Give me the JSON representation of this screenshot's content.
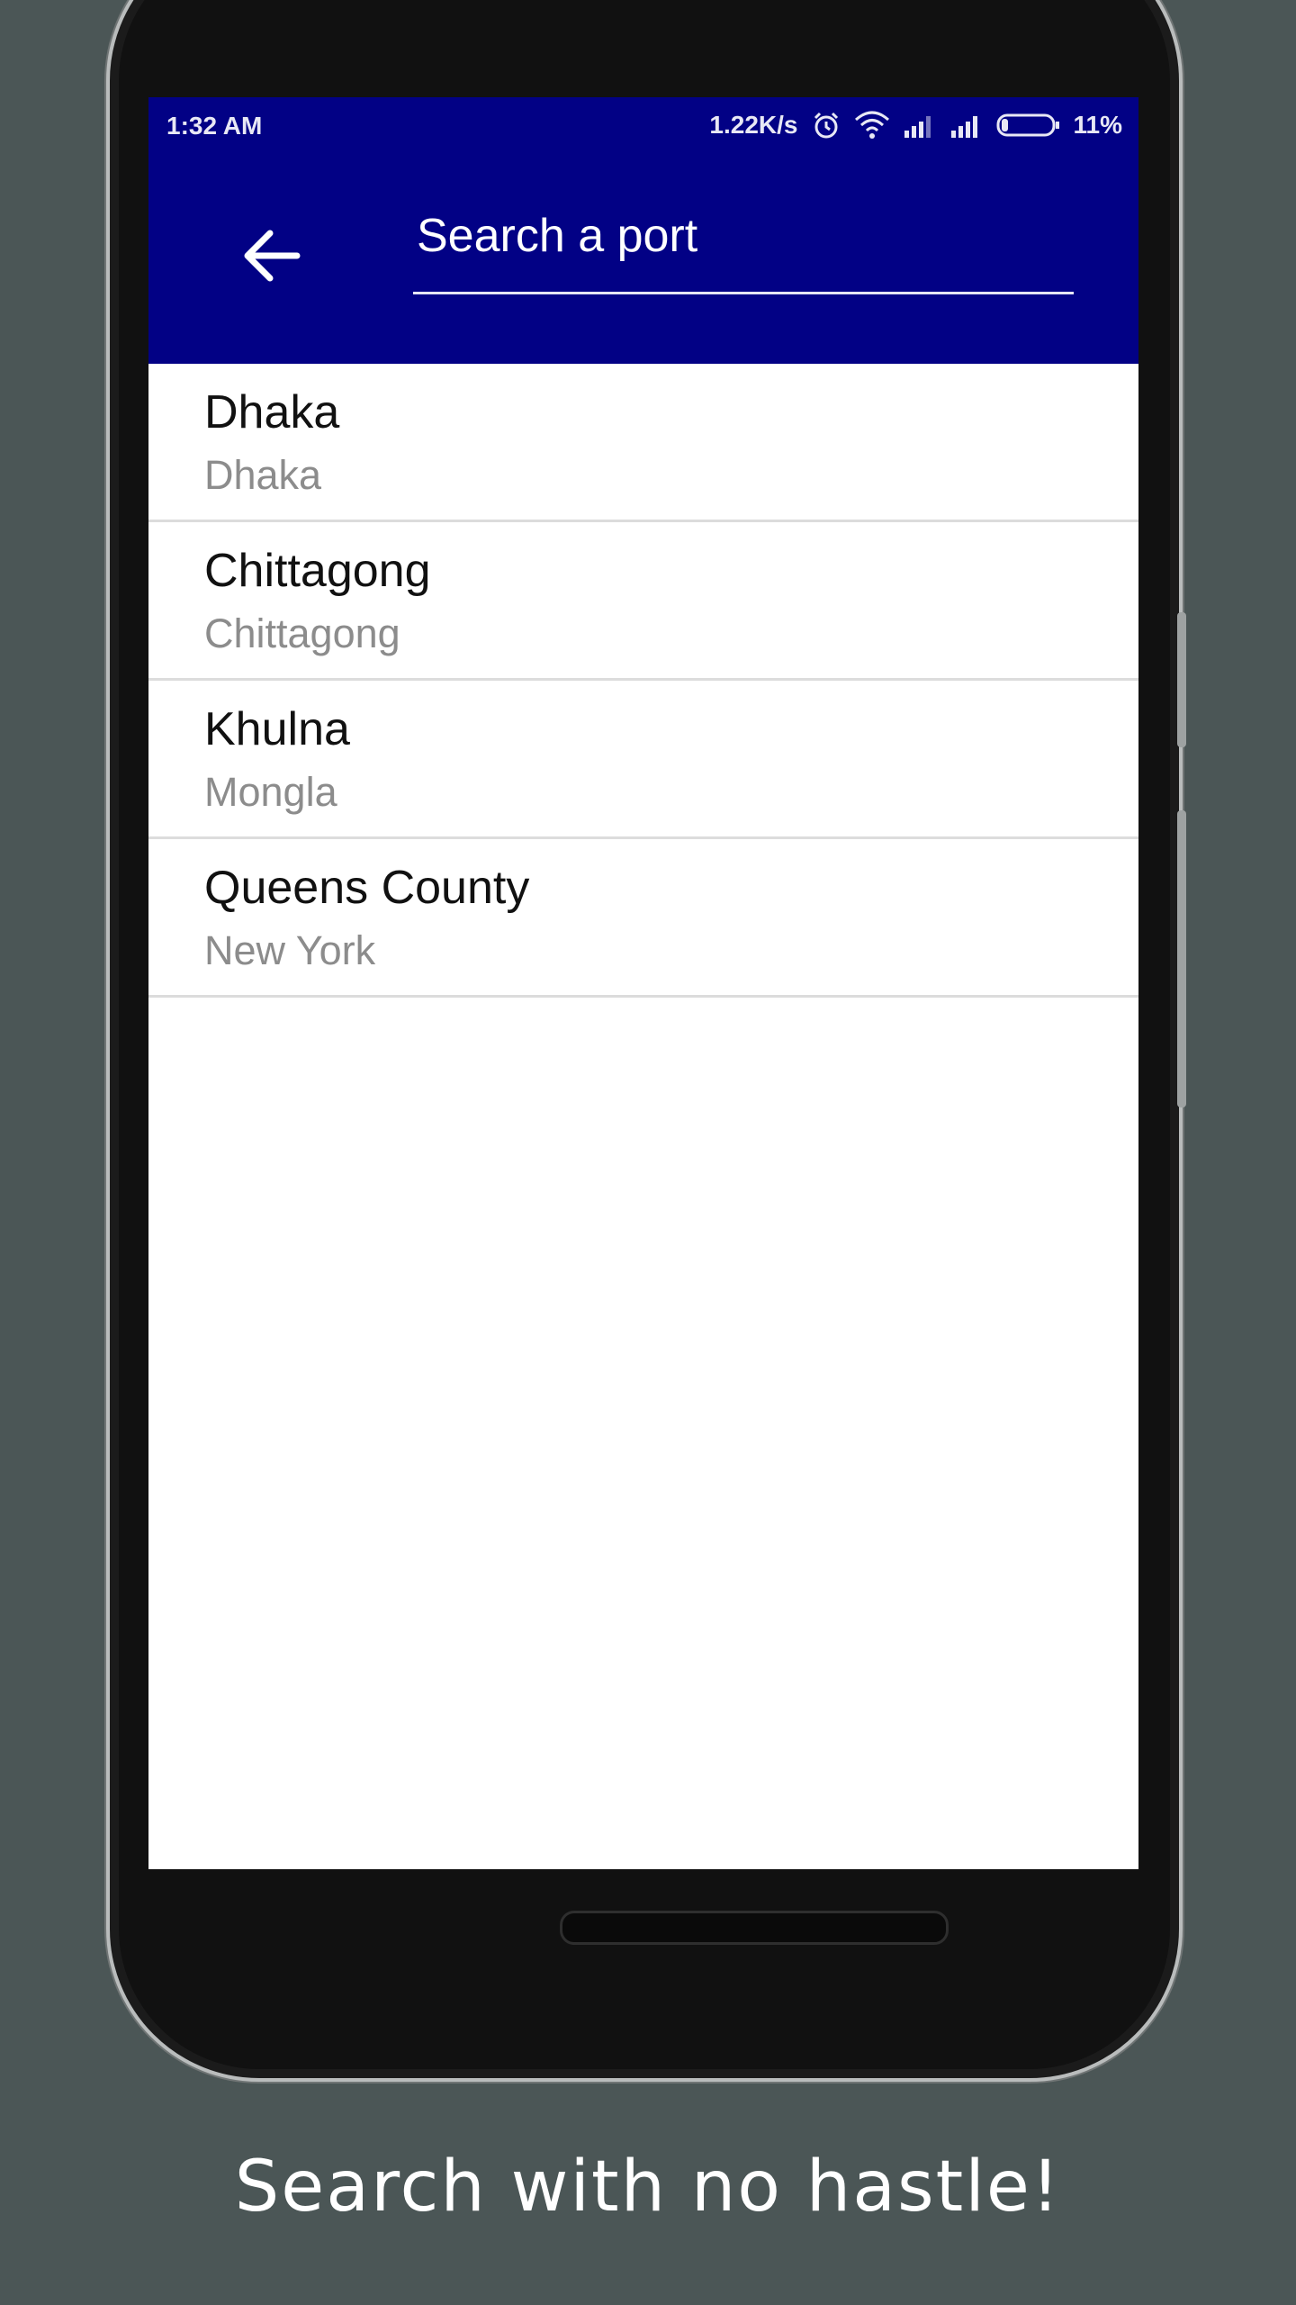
{
  "status_bar": {
    "time": "1:32 AM",
    "network_speed": "1.22K/s",
    "battery": "11%",
    "icons": [
      "alarm-icon",
      "wifi-icon",
      "signal-icon",
      "signal-icon",
      "battery-icon"
    ]
  },
  "app_bar": {
    "back_icon": "arrow-back-icon",
    "search_placeholder": "Search a port",
    "search_value": ""
  },
  "ports": [
    {
      "title": "Dhaka",
      "subtitle": "Dhaka"
    },
    {
      "title": "Chittagong",
      "subtitle": "Chittagong"
    },
    {
      "title": "Khulna",
      "subtitle": "Mongla"
    },
    {
      "title": "Queens County",
      "subtitle": "New York"
    }
  ],
  "caption": "Search with no hastle!",
  "colors": {
    "background": "#4b5656",
    "app_bar": "#020185",
    "list_background": "#ffffff",
    "subtitle": "#8c8c8c"
  }
}
